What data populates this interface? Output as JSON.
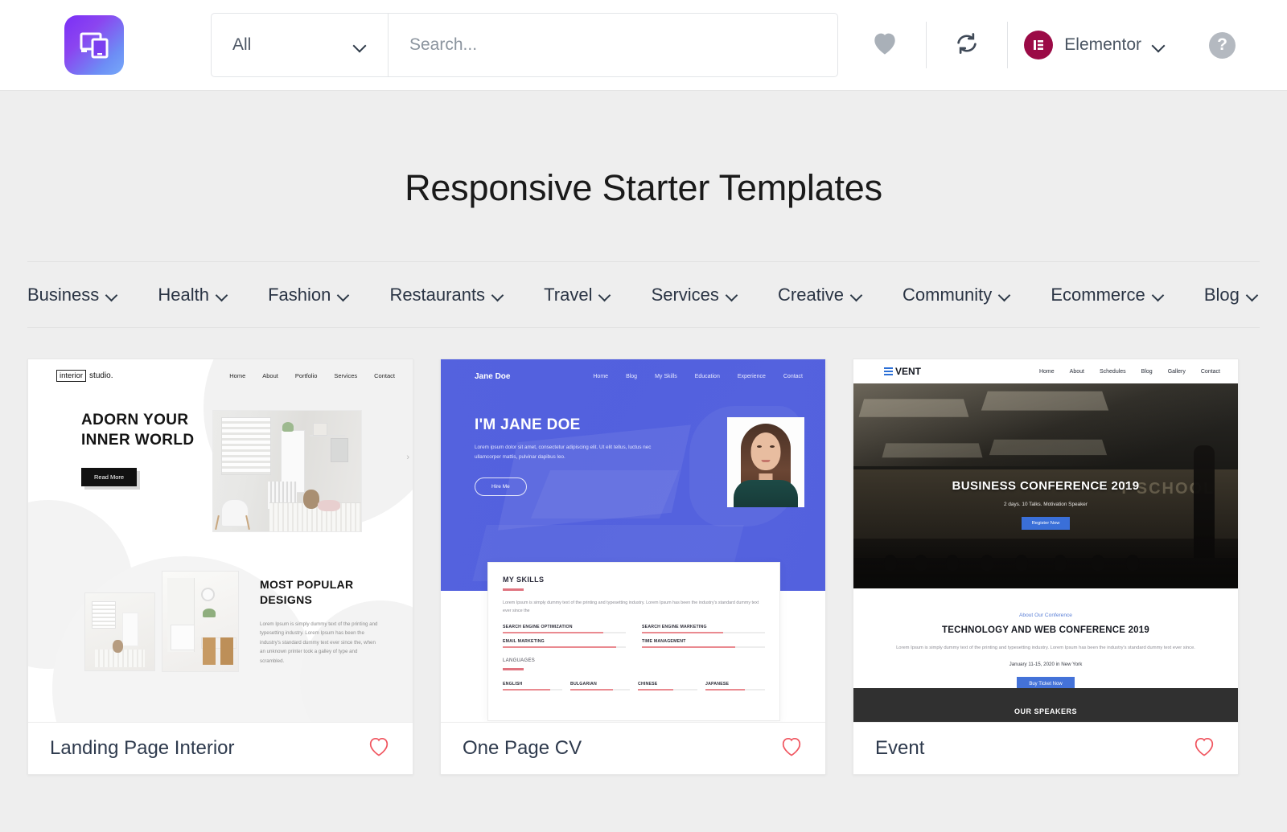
{
  "header": {
    "logo_icon": "responsive-devices-icon",
    "category_filter": {
      "value": "All",
      "chevron_icon": "chevron-down-icon"
    },
    "search": {
      "placeholder": "Search...",
      "value": ""
    },
    "favorites_icon": "heart-filled-icon",
    "sync_icon": "refresh-sync-icon",
    "account": {
      "brand_icon": "elementor-logo-icon",
      "name": "Elementor",
      "chevron_icon": "chevron-down-icon"
    },
    "help_icon": "question-mark-help-icon",
    "colors": {
      "elementor_red": "#9b0a46",
      "heart_gray": "#a9b0b8",
      "help_gray": "#b4b9c0"
    }
  },
  "page": {
    "title": "Responsive Starter Templates",
    "background": "#eeeeee"
  },
  "categories": [
    {
      "label": "Business",
      "chevron_icon": "chevron-down-icon"
    },
    {
      "label": "Health",
      "chevron_icon": "chevron-down-icon"
    },
    {
      "label": "Fashion",
      "chevron_icon": "chevron-down-icon"
    },
    {
      "label": "Restaurants",
      "chevron_icon": "chevron-down-icon"
    },
    {
      "label": "Travel",
      "chevron_icon": "chevron-down-icon"
    },
    {
      "label": "Services",
      "chevron_icon": "chevron-down-icon"
    },
    {
      "label": "Creative",
      "chevron_icon": "chevron-down-icon"
    },
    {
      "label": "Community",
      "chevron_icon": "chevron-down-icon"
    },
    {
      "label": "Ecommerce",
      "chevron_icon": "chevron-down-icon"
    },
    {
      "label": "Blog",
      "chevron_icon": "chevron-down-icon"
    }
  ],
  "templates": [
    {
      "title": "Landing Page Interior",
      "favorite_icon": "heart-outline-icon",
      "favorited": false,
      "preview": {
        "brand_boxed": "interior",
        "brand_rest": "studio.",
        "nav": [
          "Home",
          "About",
          "Portfolio",
          "Services",
          "Contact"
        ],
        "heading": "ADORN YOUR INNER WORLD",
        "button": "Read More",
        "section2_heading": "MOST POPULAR DESIGNS",
        "section2_paragraph": "Lorem Ipsum is simply dummy text of the printing and typesetting industry. Lorem Ipsum has been the industry's standard dummy text ever since the, when an unknown printer took a galley of type and scrambled.",
        "carousel_arrow_icon": "chevron-right-icon"
      }
    },
    {
      "title": "One Page CV",
      "favorite_icon": "heart-outline-icon",
      "favorited": false,
      "preview": {
        "brand": "Jane Doe",
        "nav": [
          "Home",
          "Blog",
          "My Skills",
          "Education",
          "Experience",
          "Contact"
        ],
        "heading": "I'M JANE DOE",
        "subtitle": "Lorem ipsum dolor sit amet, consectetur adipiscing elit. Ut elit tellus, luctus nec ullamcorper mattis, pulvinar dapibus leo.",
        "button": "Hire Me",
        "skills_title": "MY SKILLS",
        "skills_paragraph": "Lorem Ipsum is simply dummy text of the printing and typesetting industry. Lorem Ipsum has been the industry's standard dummy text ever since the",
        "skills": [
          {
            "label": "SEARCH ENGINE OPTIMIZATION",
            "percent": 82
          },
          {
            "label": "SEARCH ENGINE MARKETING",
            "percent": 66
          },
          {
            "label": "EMAIL MARKETING",
            "percent": 92
          },
          {
            "label": "TIME MANAGEMENT",
            "percent": 76
          }
        ],
        "languages_title": "LANGUAGES",
        "languages": [
          {
            "label": "ENGLISH",
            "percent": 80
          },
          {
            "label": "BULGARIAN",
            "percent": 72
          },
          {
            "label": "CHINESE",
            "percent": 60
          },
          {
            "label": "JAPANESE",
            "percent": 66
          }
        ],
        "hero_color": "#5260de",
        "accent_color": "#ea8a90"
      }
    },
    {
      "title": "Event",
      "favorite_icon": "heart-outline-icon",
      "favorited": false,
      "preview": {
        "brand_icon": "hamburger-bars-icon",
        "brand": "VENT",
        "nav": [
          "Home",
          "About",
          "Schedules",
          "Blog",
          "Gallery",
          "Contact"
        ],
        "heading": "BUSINESS CONFERENCE 2019",
        "subtitle": "2 days. 10 Talks. Motivation Speaker",
        "button": "Register Now",
        "background_text": "T SCHOOL",
        "eyebrow": "About Our Conference",
        "about_heading": "TECHNOLOGY AND WEB CONFERENCE 2019",
        "about_paragraph": "Lorem Ipsum is simply dummy text of the printing and typesetting industry. Lorem Ipsum has been the industry's standard dummy text ever since.",
        "date": "January 11-15, 2020 in New York",
        "about_button": "Buy Ticket Now",
        "speakers_band": "OUR SPEAKERS",
        "accent_color": "#4472d8"
      }
    }
  ]
}
